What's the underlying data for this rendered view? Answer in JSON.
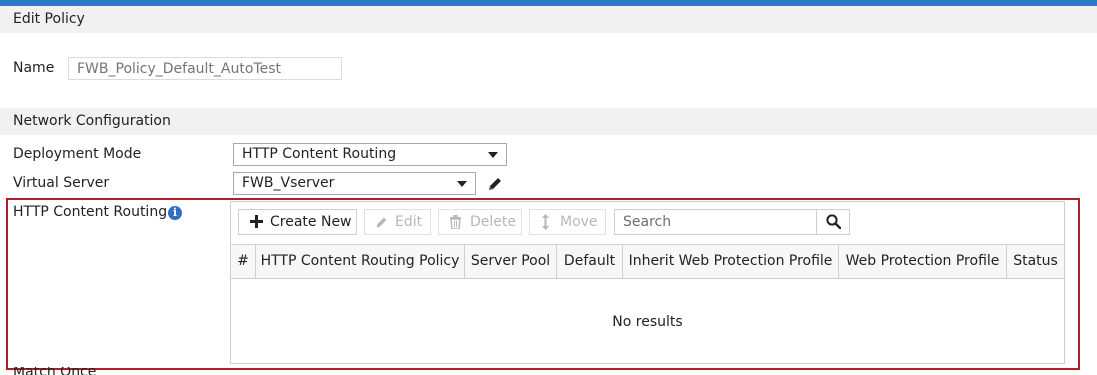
{
  "header": {
    "title": "Edit Policy",
    "accent_color": "#2f78c6"
  },
  "name_field": {
    "label": "Name",
    "placeholder": "FWB_Policy_Default_AutoTest"
  },
  "network_section": {
    "title": "Network Configuration"
  },
  "deployment_mode": {
    "label": "Deployment Mode",
    "value": "HTTP Content Routing"
  },
  "virtual_server": {
    "label": "Virtual Server",
    "value": "FWB_Vserver",
    "edit_icon": "pencil-icon"
  },
  "content_routing": {
    "label": "HTTP Content Routing",
    "info_icon": "info-icon",
    "highlight_color": "#b21d2b",
    "toolbar": {
      "create_new": "Create New",
      "edit": "Edit",
      "delete": "Delete",
      "move": "Move",
      "search_placeholder": "Search"
    },
    "columns": [
      "#",
      "HTTP Content Routing Policy",
      "Server Pool",
      "Default",
      "Inherit Web Protection Profile",
      "Web Protection Profile",
      "Status"
    ],
    "empty_text": "No results"
  },
  "partial_row": {
    "label": "Match Once"
  }
}
